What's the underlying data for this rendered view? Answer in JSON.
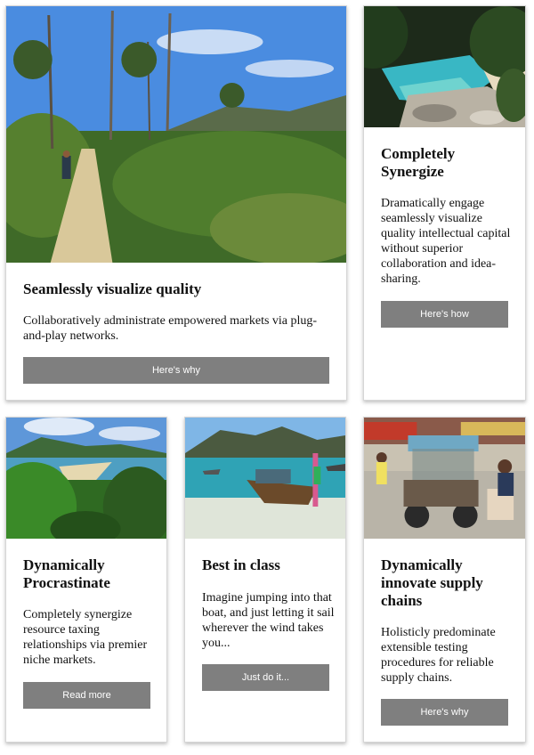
{
  "cards": [
    {
      "title": "Seamlessly visualize quality",
      "body": "Collaboratively administrate empowered markets via plug-and-play networks.",
      "button": "Here's why",
      "image": "hiking-trail-photo"
    },
    {
      "title": "Completely Synergize",
      "body": "Dramatically engage seamlessly visualize quality intellectual capital without superior collaboration and idea-sharing.",
      "button": "Here's how",
      "image": "turquoise-cove-photo"
    },
    {
      "title": "Dynamically Procrastinate",
      "body": "Completely synergize resource taxing relationships via premier niche markets.",
      "button": "Read more",
      "image": "forest-beach-photo"
    },
    {
      "title": "Best in class",
      "body": "Imagine jumping into that boat, and just letting it sail wherever the wind takes you...",
      "button": "Just do it...",
      "image": "longtail-boat-photo"
    },
    {
      "title": "Dynamically innovate supply chains",
      "body": "Holisticly predominate extensible testing procedures for reliable supply chains.",
      "button": "Here's why",
      "image": "street-vendor-photo"
    }
  ]
}
